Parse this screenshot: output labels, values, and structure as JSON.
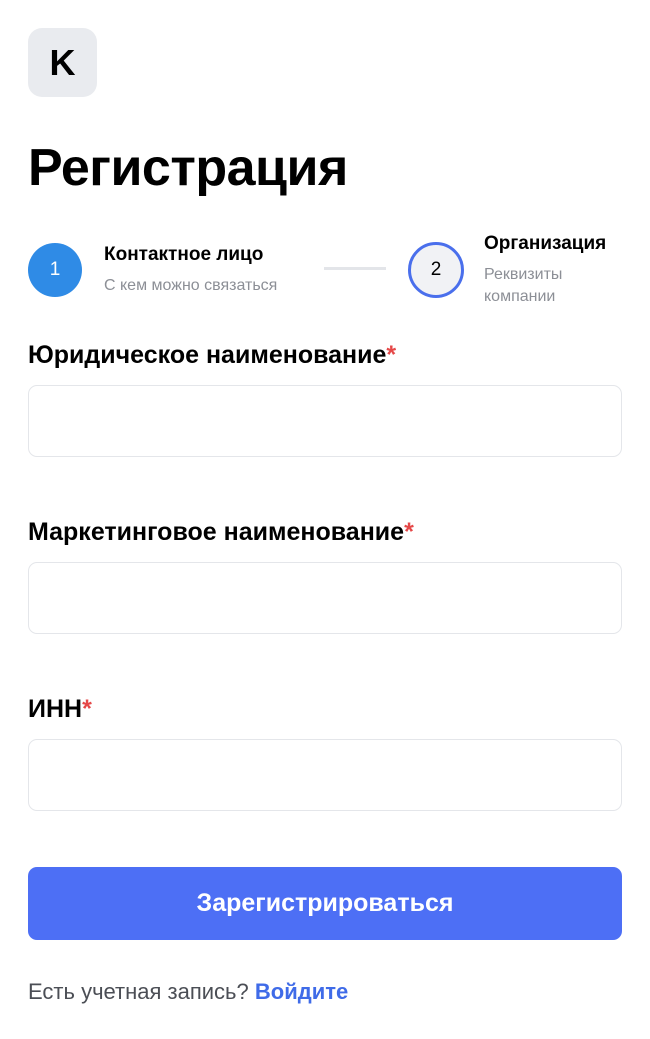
{
  "logo": {
    "letter": "K"
  },
  "page_title": "Регистрация",
  "stepper": {
    "steps": [
      {
        "number": "1",
        "title": "Контактное лицо",
        "subtitle": "С кем можно связаться",
        "state": "completed"
      },
      {
        "number": "2",
        "title": "Организация",
        "subtitle": "Реквизиты компании",
        "state": "active"
      }
    ]
  },
  "form": {
    "fields": [
      {
        "label": "Юридическое наименование",
        "required_mark": "*",
        "value": "",
        "placeholder": ""
      },
      {
        "label": "Маркетинговое наименование",
        "required_mark": "*",
        "value": "",
        "placeholder": ""
      },
      {
        "label": "ИНН",
        "required_mark": "*",
        "value": "",
        "placeholder": ""
      }
    ],
    "submit_label": "Зарегистрироваться"
  },
  "footer": {
    "question": "Есть учетная запись?",
    "login_link": "Войдите"
  },
  "colors": {
    "primary_button": "#4d6ff5",
    "step_completed": "#2f8be6",
    "step_active_border": "#4a6fec",
    "required": "#e54848",
    "link": "#3f6be8"
  }
}
